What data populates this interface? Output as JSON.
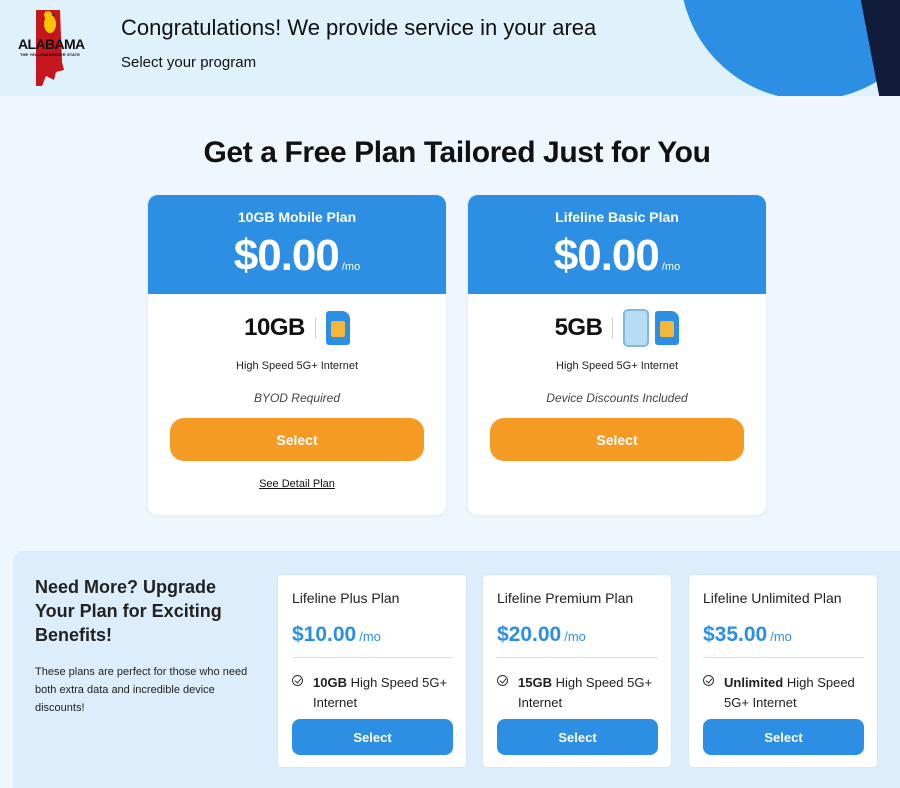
{
  "header": {
    "logo": {
      "word": "ALABAMA",
      "subtitle": "THE YELLOWHAMMER STATE"
    },
    "title": "Congratulations! We provide service in your area",
    "subtitle": "Select your program"
  },
  "main": {
    "title": "Get a Free Plan Tailored Just for You"
  },
  "free_plans": [
    {
      "name": "10GB Mobile Plan",
      "price": "$0.00",
      "per": "/mo",
      "data": "10GB",
      "icons": [
        "sim-card-icon"
      ],
      "speed": "High Speed 5G+ Internet",
      "note": "BYOD Required",
      "select_label": "Select",
      "detail_link": "See Detail Plan"
    },
    {
      "name": "Lifeline Basic Plan",
      "price": "$0.00",
      "per": "/mo",
      "data": "5GB",
      "icons": [
        "phone-icon",
        "sim-card-icon"
      ],
      "speed": "High Speed 5G+ Internet",
      "note": "Device Discounts Included",
      "select_label": "Select"
    }
  ],
  "upgrade": {
    "title": "Need More? Upgrade Your Plan for Exciting Benefits!",
    "description": "These plans are perfect for those who need both extra data and incredible device discounts!",
    "plans": [
      {
        "name": "Lifeline Plus Plan",
        "price": "$10.00",
        "per": "/mo",
        "feature_bold": "10GB",
        "feature_rest": " High Speed 5G+ Internet",
        "select_label": "Select"
      },
      {
        "name": "Lifeline Premium Plan",
        "price": "$20.00",
        "per": "/mo",
        "feature_bold": "15GB",
        "feature_rest": " High Speed 5G+ Internet",
        "select_label": "Select"
      },
      {
        "name": "Lifeline Unlimited Plan",
        "price": "$35.00",
        "per": "/mo",
        "feature_bold": "Unlimited",
        "feature_rest": " High Speed 5G+ Internet",
        "select_label": "Select"
      }
    ]
  },
  "colors": {
    "primary_blue": "#2d8fe3",
    "select_orange": "#f59b23",
    "header_bg": "#dff1fb",
    "page_bg": "#eef7fd",
    "logo_red": "#c4161c",
    "logo_yellow": "#f6c400"
  }
}
